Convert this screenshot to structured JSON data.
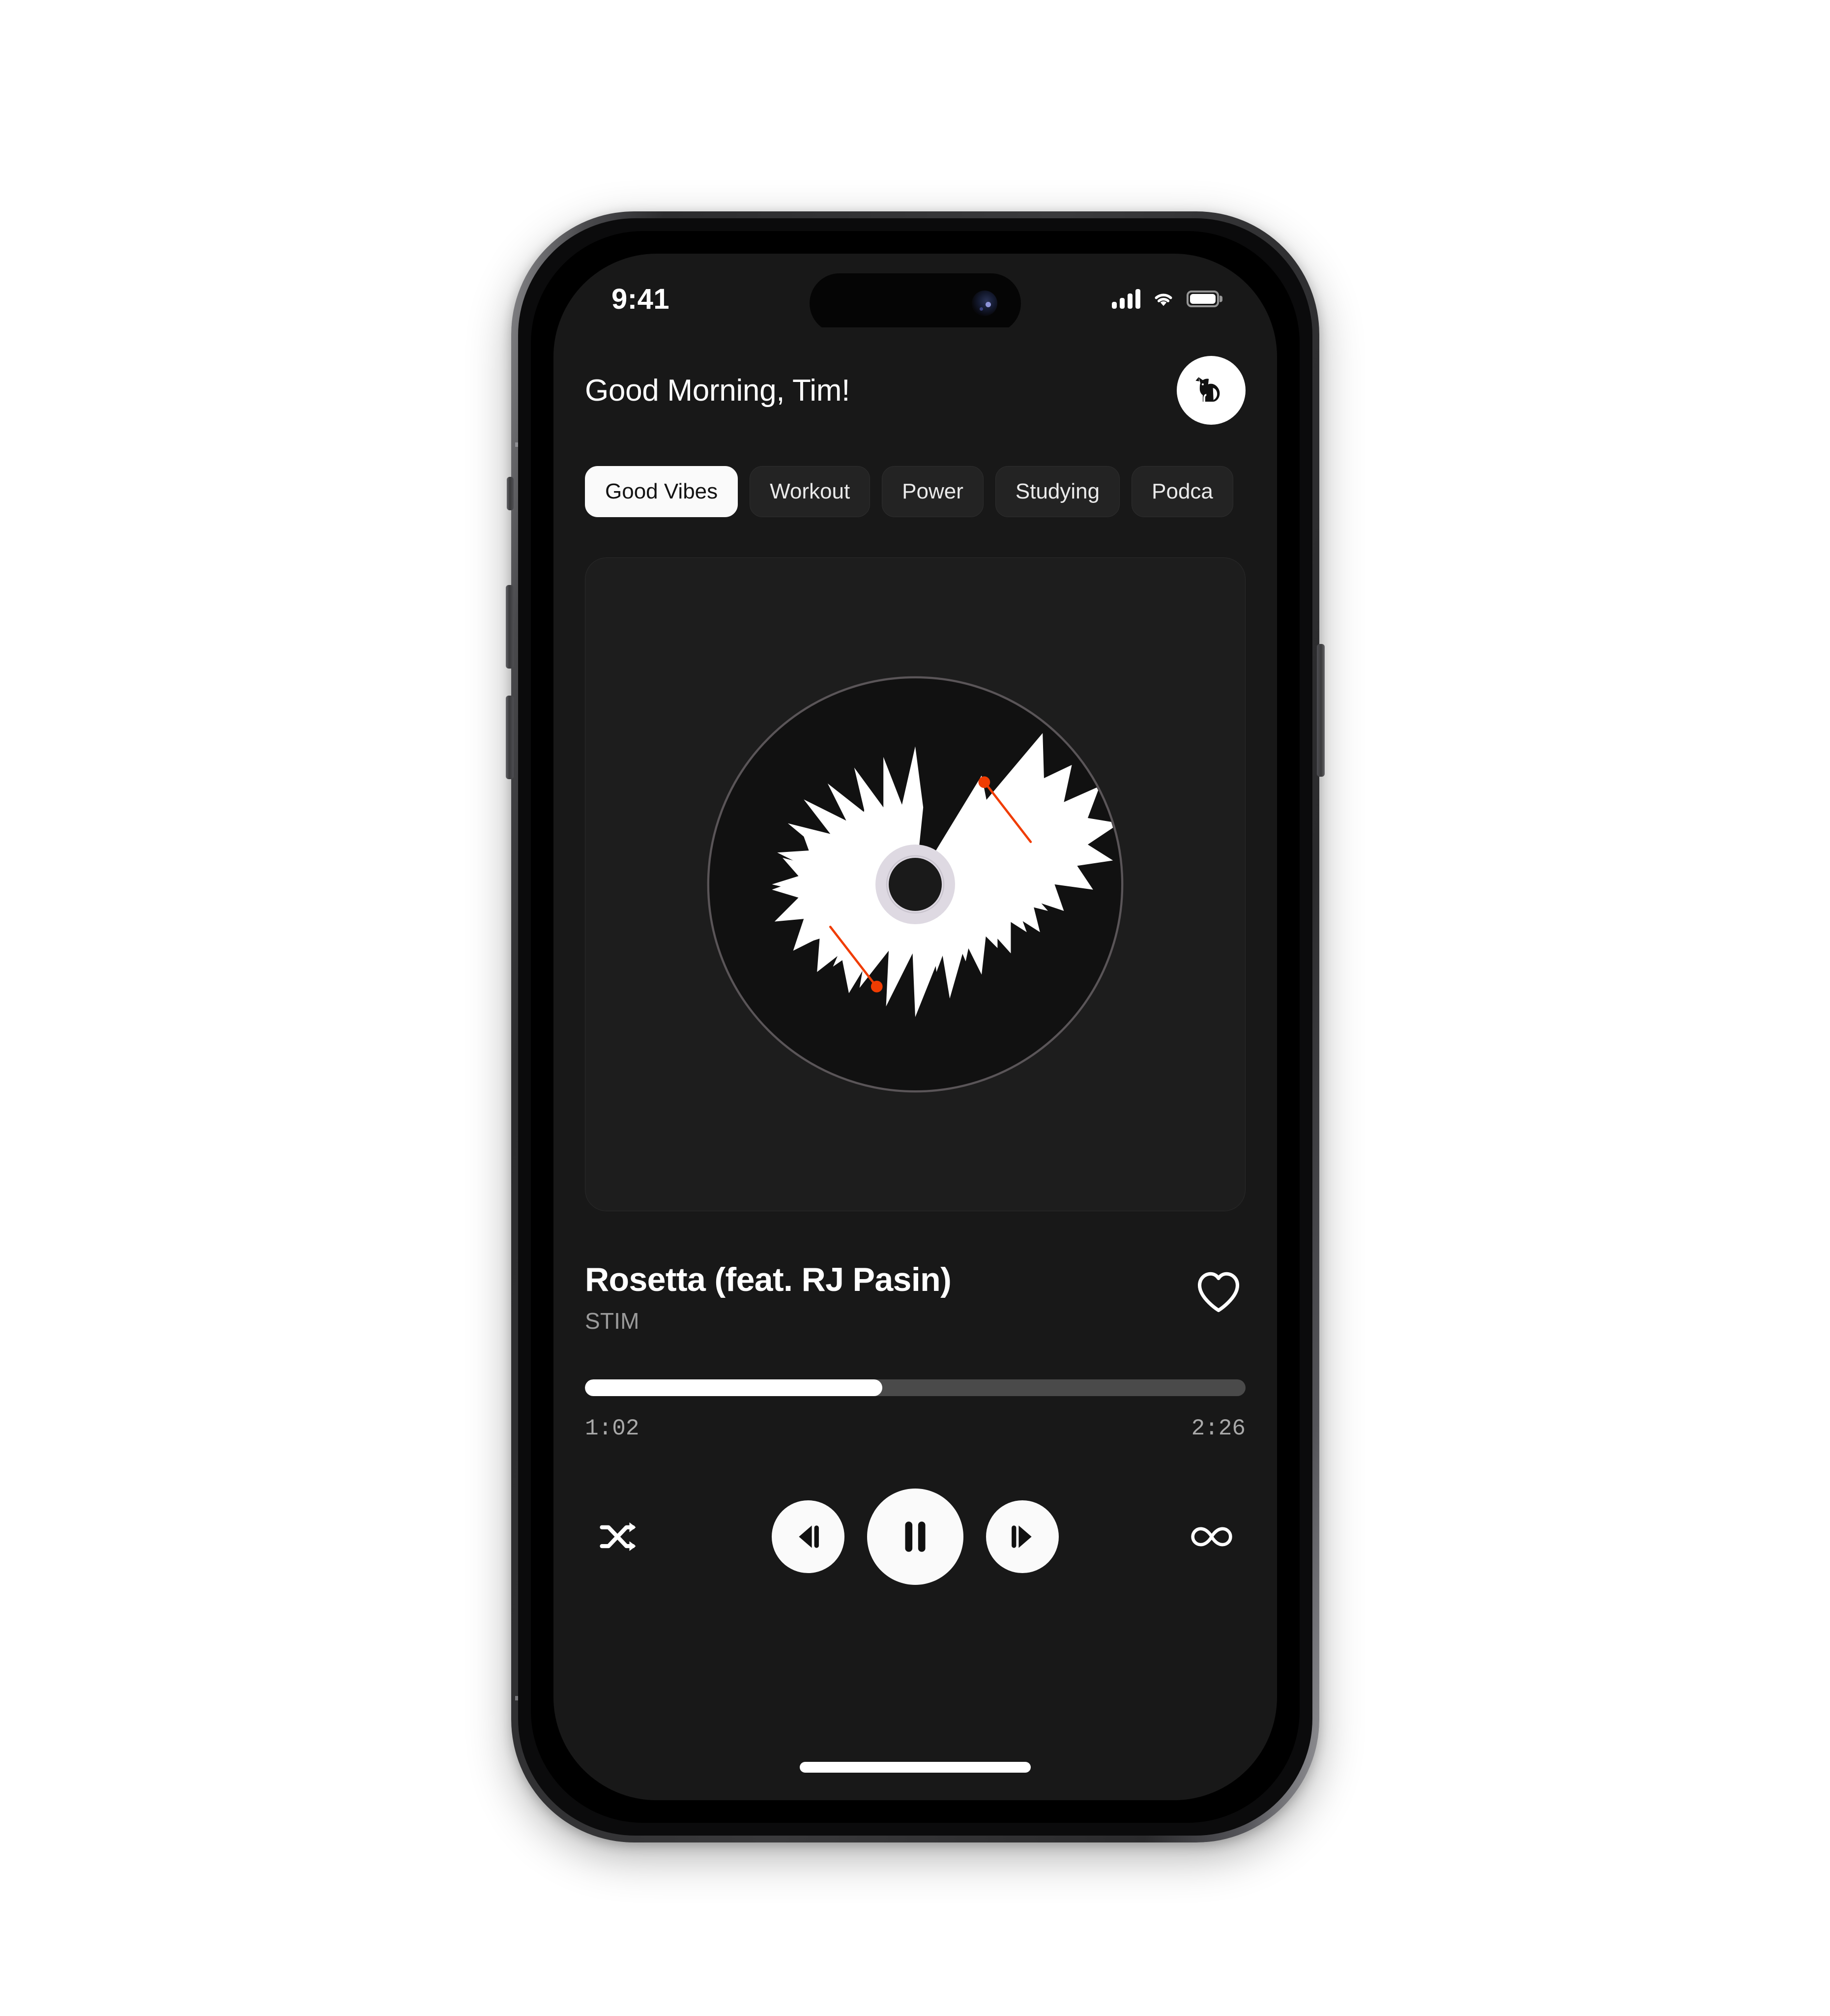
{
  "status_bar": {
    "time": "9:41",
    "cellular_icon": "cellular-signal-icon",
    "wifi_icon": "wifi-icon",
    "battery_icon": "battery-full-icon"
  },
  "header": {
    "greeting": "Good Morning, Tim!",
    "avatar_icon": "fox-avatar-icon"
  },
  "categories": {
    "items": [
      {
        "label": "Good Vibes",
        "active": true
      },
      {
        "label": "Workout",
        "active": false
      },
      {
        "label": "Power",
        "active": false
      },
      {
        "label": "Studying",
        "active": false
      },
      {
        "label": "Podca",
        "active": false
      }
    ]
  },
  "album_art": {
    "name": "vinyl-record-artwork",
    "description": "spiky-waveform-starburst-vinyl",
    "disc_color": "#111111",
    "wave_color": "#ffffff",
    "hub_ring_color": "#ded9e2",
    "hub_hole_color": "#1a1a1a",
    "tonearm_color": "#f03c02",
    "rim_color": "#5a5558"
  },
  "now_playing": {
    "title": "Rosetta (feat. RJ Pasin)",
    "artist": "STIM",
    "like_icon": "heart-outline-icon",
    "liked": false
  },
  "progress": {
    "elapsed": "1:02",
    "duration": "2:26",
    "percent": 45,
    "fill_color": "#ffffff",
    "track_color": "#4a4a4a"
  },
  "controls": {
    "shuffle_icon": "shuffle-icon",
    "previous_icon": "previous-track-icon",
    "play_pause_icon": "pause-icon",
    "next_icon": "next-track-icon",
    "repeat_icon": "infinity-repeat-icon",
    "is_playing": true
  },
  "system": {
    "home_indicator": "home-indicator-bar"
  },
  "theme": {
    "page_background": "#ffffff",
    "app_background": "#181818",
    "card_background": "#1d1d1d",
    "accent": "#f03c02",
    "text_primary": "#ffffff",
    "text_secondary": "#9a9a9a",
    "chip_active_bg": "#fafafa"
  }
}
